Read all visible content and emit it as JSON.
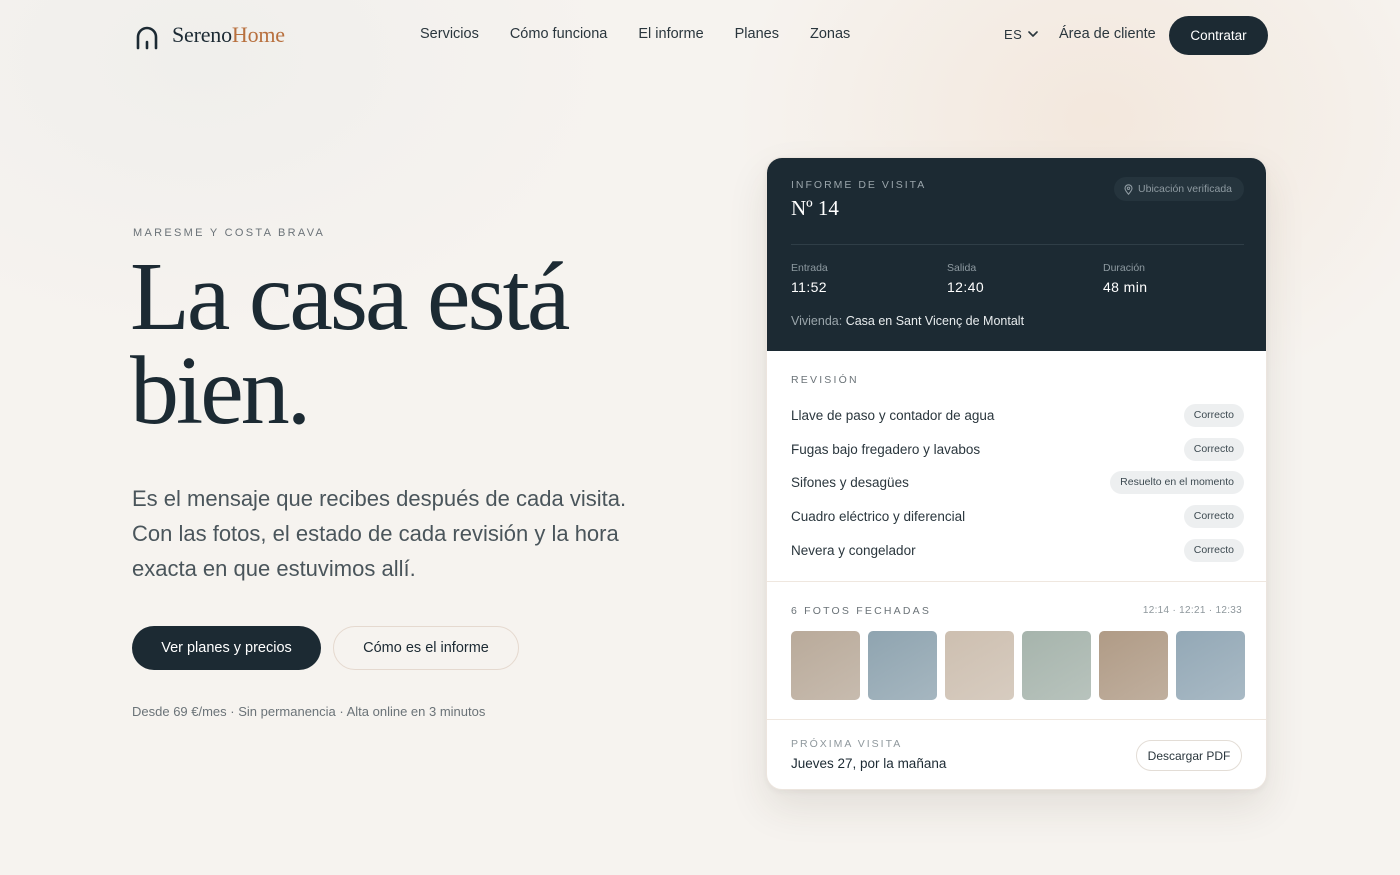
{
  "nav": {
    "brand_part1": "Sereno",
    "brand_part2": "Home",
    "links": [
      "Servicios",
      "Cómo funciona",
      "El informe",
      "Planes",
      "Zonas"
    ],
    "lang": "ES",
    "client_area": "Área de cliente",
    "cta": "Contratar"
  },
  "hero": {
    "eyebrow": "MARESME Y COSTA BRAVA",
    "title_line1": "La casa está",
    "title_line2": "bien.",
    "subtitle_lines": [
      "Es el mensaje que recibes después de cada visita.",
      "Con las fotos, el estado de cada revisión y la hora",
      "exacta en que estuvimos allí."
    ],
    "primary_cta": "Ver planes y precios",
    "secondary_cta": "Cómo es el informe",
    "note": "Desde 69 €/mes · Sin permanencia · Alta online en 3 minutos"
  },
  "card": {
    "eyebrow": "INFORME DE VISITA",
    "number": "Nº 14",
    "badge": "Ubicación verificada",
    "stats": [
      {
        "label": "Entrada",
        "value": "11:52"
      },
      {
        "label": "Salida",
        "value": "12:40"
      },
      {
        "label": "Duración",
        "value": "48 min"
      }
    ],
    "home_label": "Vivienda:",
    "home_value": "Casa en Sant Vicenç de Montalt",
    "review_title": "REVISIÓN",
    "reviews": [
      {
        "label": "Llave de paso y contador de agua",
        "status": "Correcto"
      },
      {
        "label": "Fugas bajo fregadero y lavabos",
        "status": "Correcto"
      },
      {
        "label": "Sifones y desagües",
        "status": "Resuelto en el momento"
      },
      {
        "label": "Cuadro eléctrico y diferencial",
        "status": "Correcto"
      },
      {
        "label": "Nevera y congelador",
        "status": "Correcto"
      }
    ],
    "photos_title": "6 FOTOS FECHADAS",
    "photos_times": "12:14 · 12:21 · 12:33",
    "photo_colors": [
      "#b9aa9a",
      "#8fa4b0",
      "#cdbfb0",
      "#a6b4ac",
      "#b09b86",
      "#93a8b6"
    ],
    "next_label": "PRÓXIMA VISITA",
    "next_value": "Jueves 27, por la mañana",
    "pdf_button": "Descargar PDF"
  }
}
